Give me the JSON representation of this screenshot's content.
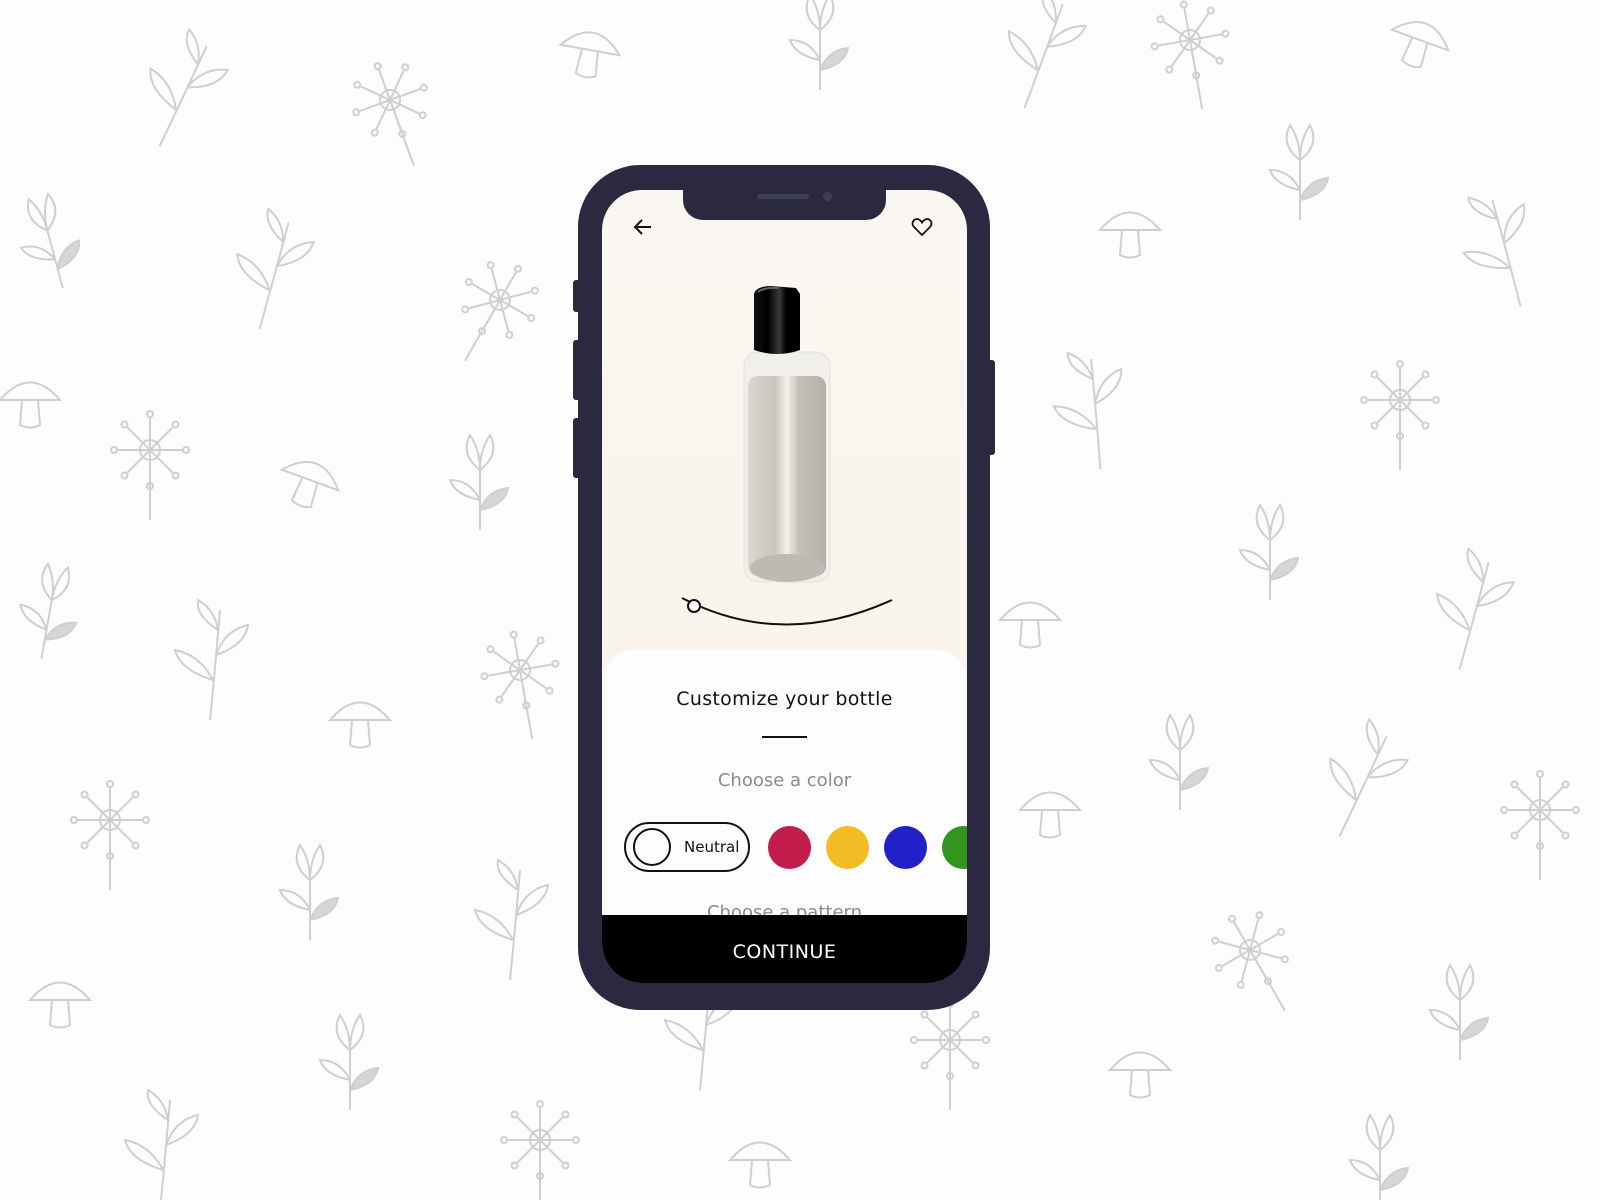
{
  "colors": {
    "frame": "#2a2940",
    "background": "#fdfdfd",
    "doodle": "#cfcfcf",
    "cta": "#000000"
  },
  "header": {
    "back_icon": "arrow-left-icon",
    "favorite_icon": "heart-outline-icon"
  },
  "product": {
    "name": "bottle",
    "cap_color": "#000000"
  },
  "sheet": {
    "title": "Customize your bottle",
    "color_label": "Choose a color",
    "selected_color": "Neutral",
    "swatches": [
      {
        "name": "Neutral",
        "hex": "#ffffff",
        "selected": true
      },
      {
        "name": "red",
        "hex": "#c21d4d"
      },
      {
        "name": "yellow",
        "hex": "#f2bd24"
      },
      {
        "name": "blue",
        "hex": "#2121c7"
      },
      {
        "name": "green",
        "hex": "#34951e"
      }
    ],
    "pattern_label": "Choose a pattern"
  },
  "cta": {
    "label": "CONTINUE"
  }
}
